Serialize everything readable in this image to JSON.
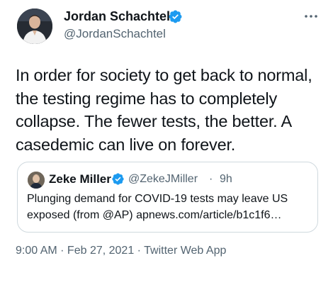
{
  "author": {
    "name": "Jordan Schachtel",
    "handle": "@JordanSchachtel",
    "verified_icon": "verified-badge-icon",
    "avatar_icon": "profile-photo"
  },
  "more_icon": "more-horizontal-icon",
  "tweet": {
    "text": "In order for society to get back to normal, the testing regime has to completely collapse. The fewer tests, the better. A casedemic can live on forever."
  },
  "quote": {
    "name": "Zeke Miller",
    "handle": "@ZekeJMiller",
    "separator": "·",
    "time": "9h",
    "text": "Plunging demand for COVID-19 tests may leave US exposed (from @AP) apnews.com/article/b1c1f6…"
  },
  "meta": {
    "time": "9:00 AM",
    "separator1": " · ",
    "date": "Feb 27, 2021",
    "separator2": " · ",
    "source": "Twitter Web App"
  },
  "colors": {
    "text": "#0f1419",
    "secondary": "#536471",
    "verified": "#1d9bf0",
    "border": "#cfd9de"
  }
}
